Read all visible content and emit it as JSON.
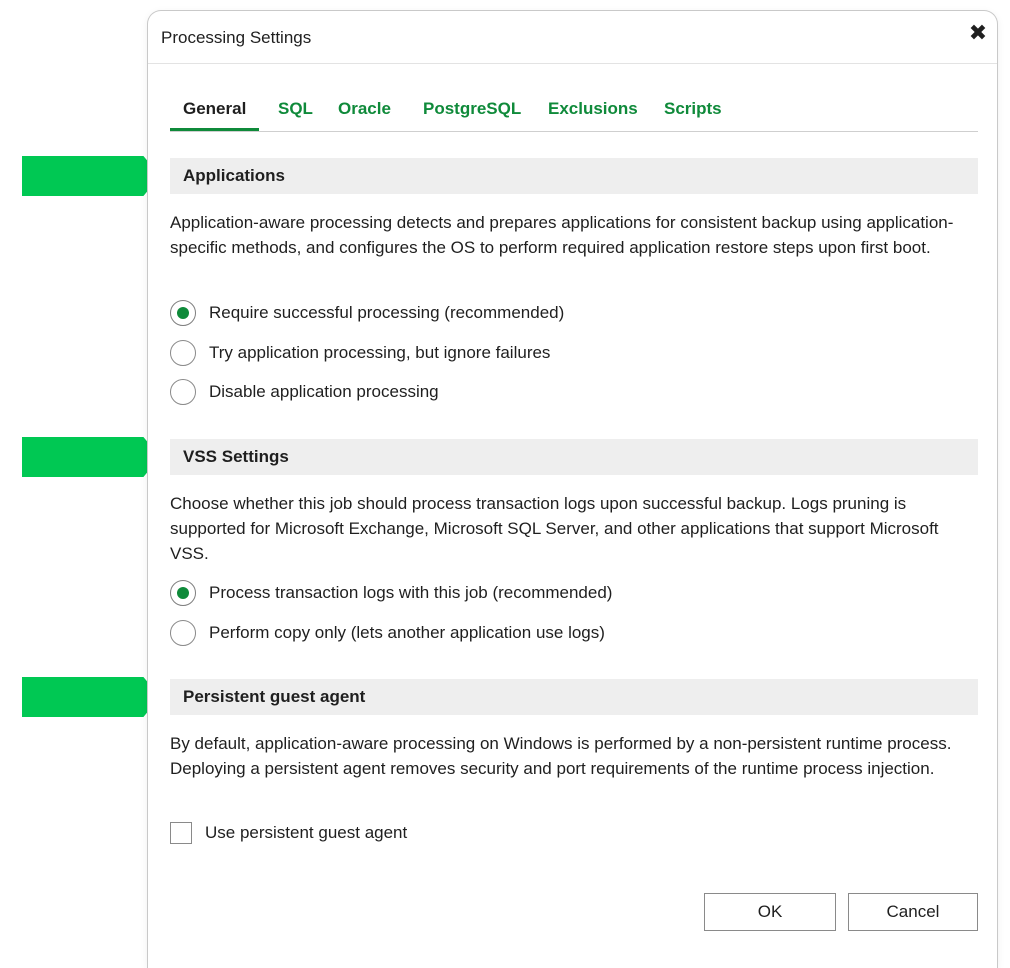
{
  "colors": {
    "accent": "#0f8a3a",
    "arrow": "#00c853",
    "section_bg": "#eeeeee"
  },
  "dialog": {
    "title": "Processing Settings",
    "close_icon": "close-icon"
  },
  "tabs": [
    {
      "label": "General",
      "active": true
    },
    {
      "label": "SQL",
      "active": false
    },
    {
      "label": "Oracle",
      "active": false
    },
    {
      "label": "PostgreSQL",
      "active": false
    },
    {
      "label": "Exclusions",
      "active": false
    },
    {
      "label": "Scripts",
      "active": false
    }
  ],
  "applications": {
    "header": "Applications",
    "description": "Application-aware processing detects and prepares applications for consistent backup using application-specific methods, and configures the OS to perform required application restore steps upon first boot.",
    "options": [
      {
        "label": "Require successful processing (recommended)",
        "checked": true
      },
      {
        "label": "Try application processing, but ignore failures",
        "checked": false
      },
      {
        "label": "Disable application processing",
        "checked": false
      }
    ]
  },
  "vss": {
    "header": "VSS Settings",
    "description": "Choose whether this job should process transaction logs upon successful backup. Logs pruning is supported for Microsoft Exchange, Microsoft SQL Server, and other applications that support Microsoft VSS.",
    "options": [
      {
        "label": "Process transaction logs with this job (recommended)",
        "checked": true
      },
      {
        "label": "Perform copy only (lets another application use logs)",
        "checked": false
      }
    ]
  },
  "persistent": {
    "header": "Persistent guest agent",
    "description": "By default, application-aware processing on Windows is performed by a non-persistent runtime process. Deploying a persistent agent removes security and port requirements of the runtime process injection.",
    "checkbox": {
      "label": "Use persistent guest agent",
      "checked": false
    }
  },
  "buttons": {
    "ok": "OK",
    "cancel": "Cancel"
  }
}
